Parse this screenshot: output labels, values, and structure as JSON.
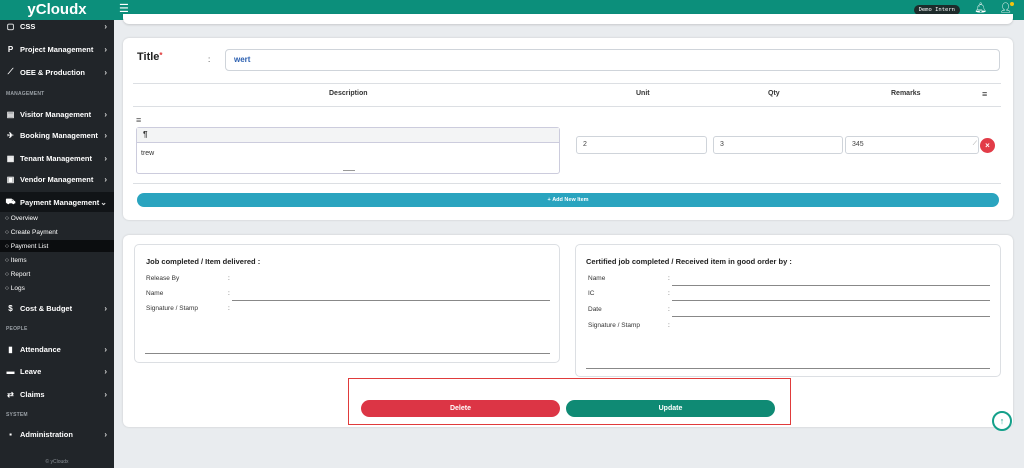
{
  "app": {
    "brand": "yCloudx"
  },
  "topbar": {
    "user_badge": "Demo Intern"
  },
  "sidebar": {
    "items": [
      {
        "label": "CSS",
        "icon": "css-icon"
      },
      {
        "label": "Project Management",
        "icon": "project-icon"
      },
      {
        "label": "OEE & Production",
        "icon": "chart-line-icon"
      }
    ],
    "section_management": "MANAGEMENT",
    "management_items": [
      {
        "label": "Visitor Management",
        "icon": "id-card-icon"
      },
      {
        "label": "Booking Management",
        "icon": "plane-icon"
      },
      {
        "label": "Tenant Management",
        "icon": "building-icon"
      },
      {
        "label": "Vendor Management",
        "icon": "vendor-icon"
      },
      {
        "label": "Payment Management",
        "icon": "cart-icon"
      }
    ],
    "payment_sub": [
      "Overview",
      "Create Payment",
      "Payment List",
      "Items",
      "Report",
      "Logs"
    ],
    "cost_budget": {
      "label": "Cost & Budget",
      "icon": "dollar-icon"
    },
    "section_people": "PEOPLE",
    "people_items": [
      {
        "label": "Attendance",
        "icon": "document-icon"
      },
      {
        "label": "Leave",
        "icon": "suitcase-icon"
      },
      {
        "label": "Claims",
        "icon": "transfer-icon"
      }
    ],
    "section_system": "SYSTEM",
    "system_items": [
      {
        "label": "Administration",
        "icon": "admin-icon"
      }
    ],
    "footer": "© yCloudx"
  },
  "form": {
    "title_label": "Title",
    "title_required": "*",
    "colon": ":",
    "title_value": "wert",
    "columns": {
      "description": "Description",
      "unit": "Unit",
      "qty": "Qty",
      "remarks": "Remarks"
    },
    "item": {
      "toolbar_symbol": "¶",
      "description": "trew",
      "unit": "2",
      "qty": "3",
      "remarks": "345"
    },
    "add_item_label": "Add New Item"
  },
  "signatures": {
    "left": {
      "title": "Job completed / Item delivered :",
      "fields": [
        "Release By",
        "Name",
        "Signature / Stamp"
      ]
    },
    "right": {
      "title": "Certified job completed / Received item in good order by :",
      "fields": [
        "Name",
        "IC",
        "Date",
        "Signature / Stamp"
      ]
    }
  },
  "actions": {
    "delete_label": "Delete",
    "update_label": "Update"
  }
}
